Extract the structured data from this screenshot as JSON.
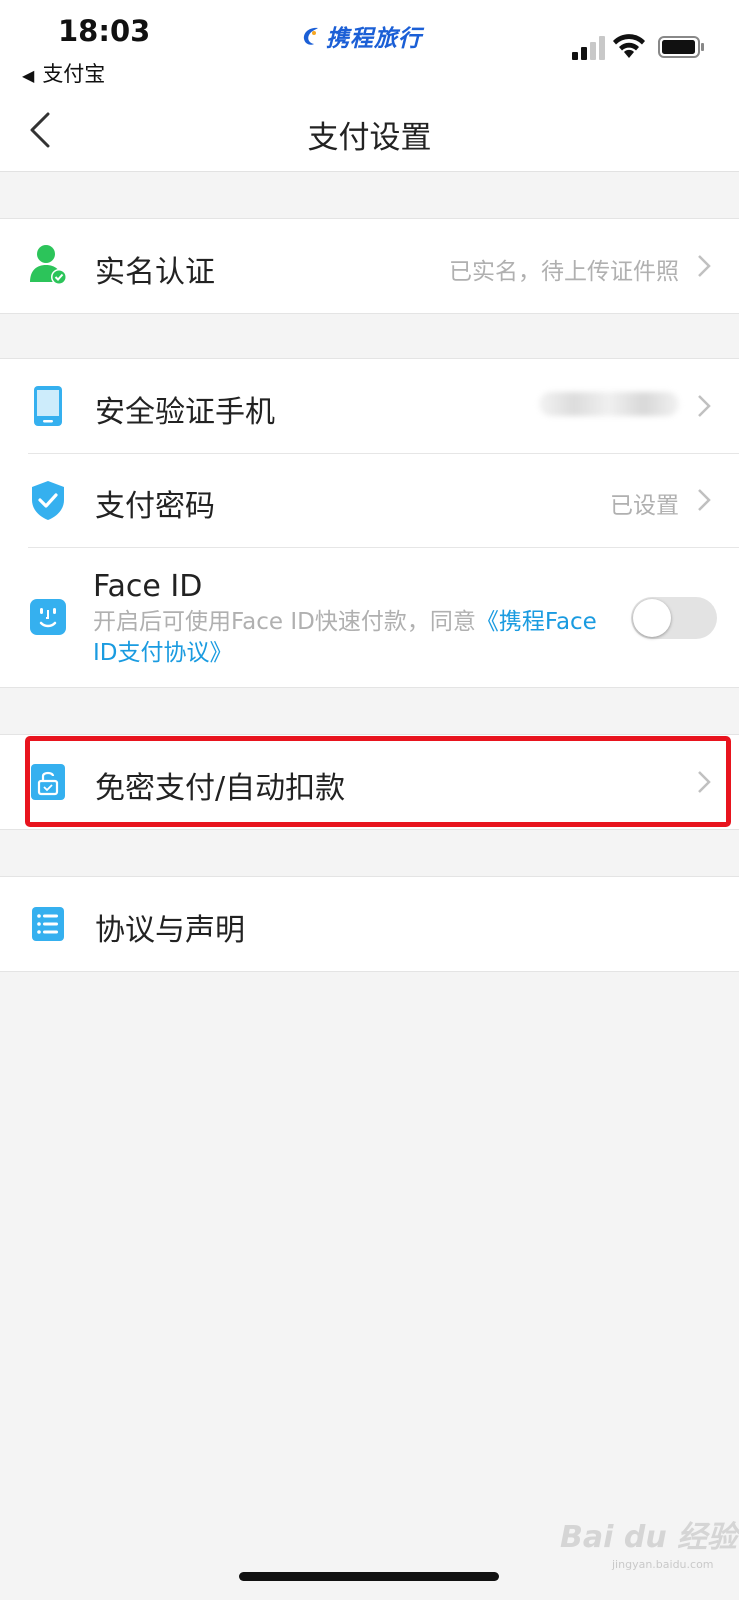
{
  "status_bar": {
    "time": "18:03",
    "back_app": "支付宝",
    "brand": "携程旅行"
  },
  "nav": {
    "title": "支付设置"
  },
  "groups": {
    "identity": {
      "label": "实名认证",
      "value": "已实名，待上传证件照"
    },
    "security": {
      "phone_label": "安全验证手机",
      "password_label": "支付密码",
      "password_value": "已设置",
      "face_id": {
        "title": "Face ID",
        "desc_prefix": "开启后可使用Face ID快速付款，同意",
        "desc_link": "《携程Face ID支付协议》",
        "enabled": false
      }
    },
    "autopay": {
      "label": "免密支付/自动扣款"
    },
    "agreements": {
      "label": "协议与声明"
    }
  },
  "watermark": {
    "text": "Bai du 经验",
    "sub": "jingyan.baidu.com"
  },
  "colors": {
    "accent_blue": "#35b0ef",
    "green": "#2cc45a",
    "highlight_red": "#e8141e",
    "link_blue": "#1a9be0"
  }
}
